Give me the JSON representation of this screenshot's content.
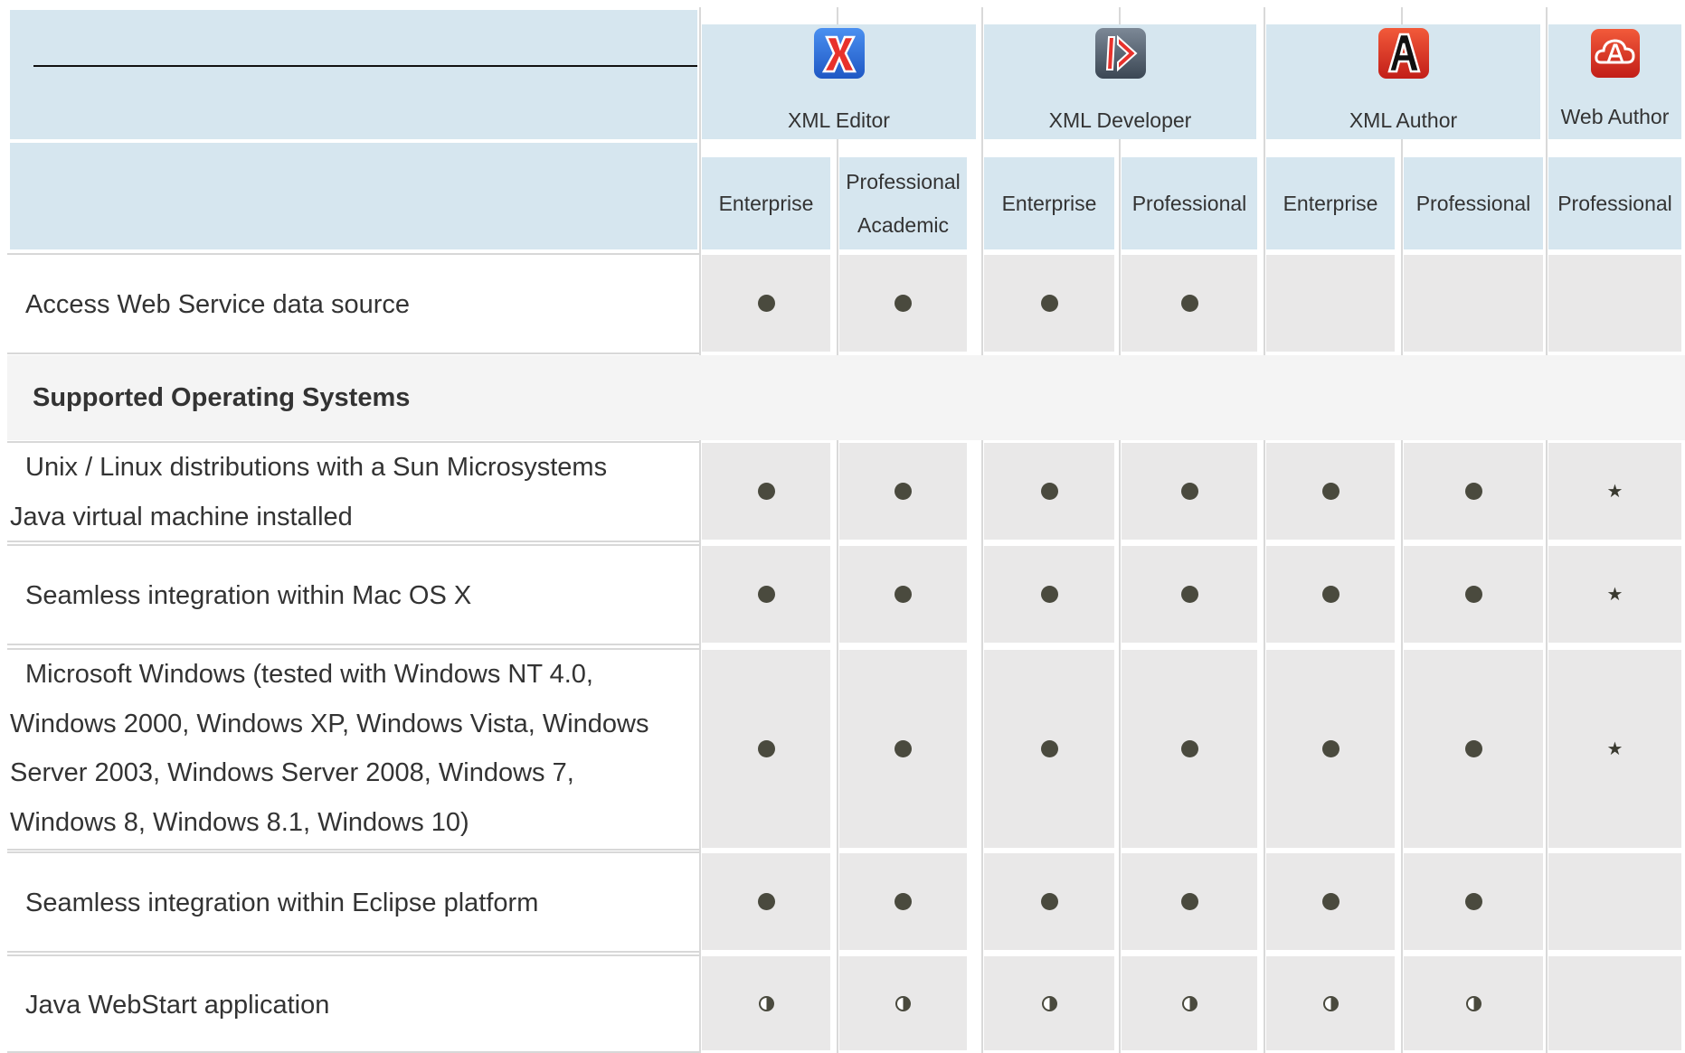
{
  "products": [
    {
      "name": "XML Editor",
      "icon": "xml-editor-icon",
      "color": "#2f6fd6"
    },
    {
      "name": "XML Developer",
      "icon": "xml-developer-icon",
      "color": "#5a6a7a"
    },
    {
      "name": "XML Author",
      "icon": "xml-author-icon",
      "color": "#d7302a"
    },
    {
      "name": "Web Author",
      "icon": "web-author-icon",
      "color": "#d8302a"
    }
  ],
  "editions": [
    {
      "lines": [
        "Enterprise"
      ]
    },
    {
      "lines": [
        "Professional",
        "Academic"
      ]
    },
    {
      "lines": [
        "Enterprise"
      ]
    },
    {
      "lines": [
        "Professional"
      ]
    },
    {
      "lines": [
        "Enterprise"
      ]
    },
    {
      "lines": [
        "Professional"
      ]
    },
    {
      "lines": [
        "Professional"
      ]
    }
  ],
  "rows": [
    {
      "type": "feature",
      "lines": [
        "Access Web Service data source"
      ],
      "marks": [
        "full",
        "full",
        "full",
        "full",
        "none",
        "none",
        "none"
      ]
    },
    {
      "type": "section",
      "label": "Supported Operating Systems"
    },
    {
      "type": "feature",
      "lines": [
        "Unix / Linux distributions with a Sun Microsystems",
        "Java virtual machine installed"
      ],
      "marks": [
        "full",
        "full",
        "full",
        "full",
        "full",
        "full",
        "star"
      ]
    },
    {
      "type": "feature",
      "lines": [
        "Seamless integration within Mac OS X"
      ],
      "marks": [
        "full",
        "full",
        "full",
        "full",
        "full",
        "full",
        "star"
      ]
    },
    {
      "type": "feature",
      "lines": [
        "Microsoft Windows (tested with Windows NT 4.0,",
        "Windows 2000, Windows XP, Windows Vista, Windows",
        "Server 2003, Windows Server 2008, Windows 7,",
        "Windows 8, Windows 8.1, Windows 10)"
      ],
      "marks": [
        "full",
        "full",
        "full",
        "full",
        "full",
        "full",
        "star"
      ]
    },
    {
      "type": "feature",
      "lines": [
        "Seamless integration within Eclipse platform"
      ],
      "marks": [
        "full",
        "full",
        "full",
        "full",
        "full",
        "full",
        "none"
      ]
    },
    {
      "type": "feature",
      "lines": [
        "Java WebStart application"
      ],
      "marks": [
        "half",
        "half",
        "half",
        "half",
        "half",
        "half",
        "none"
      ]
    }
  ],
  "colors": {
    "header_bg": "#d6e6ef",
    "cell_bg": "#e9e8e8",
    "section_bg": "#f4f4f4",
    "mark": "#4a4a3e"
  }
}
